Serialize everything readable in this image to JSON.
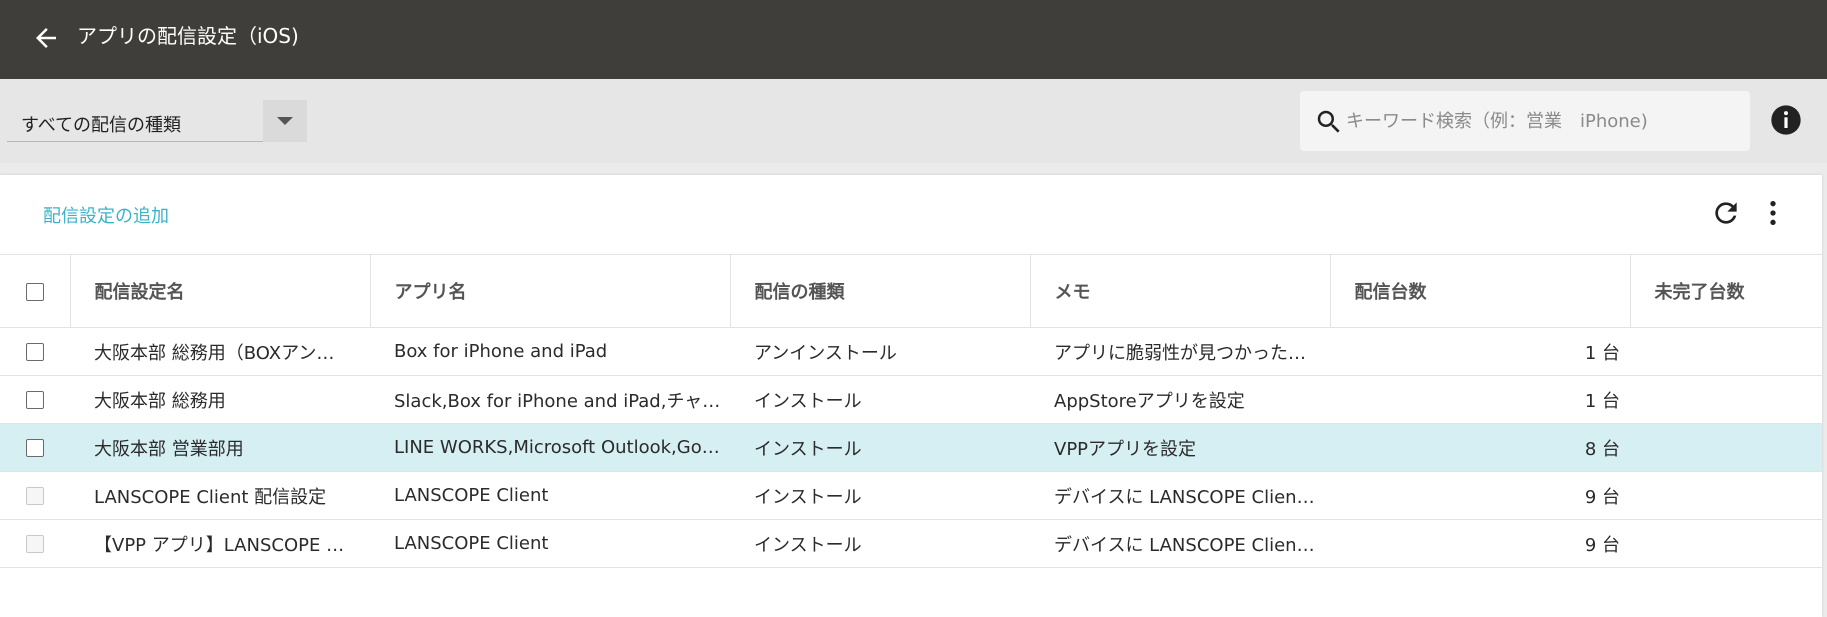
{
  "header": {
    "title": "アプリの配信設定（iOS)",
    "back_icon": "arrow-left-icon"
  },
  "filter": {
    "type_select_value": "すべての配信の種類",
    "search_placeholder": "キーワード検索（例：営業　iPhone)"
  },
  "toolbar": {
    "add_label": "配信設定の追加"
  },
  "table": {
    "columns": [
      "配信設定名",
      "アプリ名",
      "配信の種類",
      "メモ",
      "配信台数",
      "未完了台数"
    ],
    "rows": [
      {
        "name": "大阪本部 総務用（BOXアン…",
        "app": "Box for iPhone and iPad",
        "type": "アンインストール",
        "memo": "アプリに脆弱性が見つかった…",
        "count": "1 台",
        "incomplete": "",
        "selected": false,
        "enabled": true
      },
      {
        "name": "大阪本部 総務用",
        "app": "Slack,Box for iPhone and iPad,チャ…",
        "type": "インストール",
        "memo": "AppStoreアプリを設定",
        "count": "1 台",
        "incomplete": "",
        "selected": false,
        "enabled": true
      },
      {
        "name": "大阪本部 営業部用",
        "app": "LINE WORKS,Microsoft Outlook,Goo…",
        "type": "インストール",
        "memo": "VPPアプリを設定",
        "count": "8 台",
        "incomplete": "",
        "selected": true,
        "enabled": true
      },
      {
        "name": "LANSCOPE Client 配信設定",
        "app": "LANSCOPE Client",
        "type": "インストール",
        "memo": "デバイスに LANSCOPE Clien…",
        "count": "9 台",
        "incomplete": "",
        "selected": false,
        "enabled": false
      },
      {
        "name": "【VPP アプリ】LANSCOPE …",
        "app": "LANSCOPE Client",
        "type": "インストール",
        "memo": "デバイスに LANSCOPE Clien…",
        "count": "9 台",
        "incomplete": "",
        "selected": false,
        "enabled": false
      }
    ]
  },
  "colors": {
    "topbar": "#403e3b",
    "accent": "#3ab3c8",
    "selected_row": "#d6eff3"
  }
}
